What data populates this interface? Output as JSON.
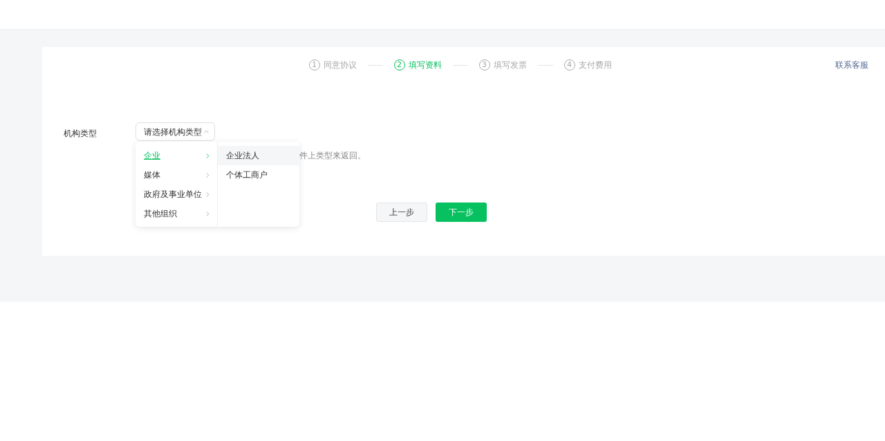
{
  "steps": [
    {
      "number": "1",
      "label": "同意协议",
      "selected": false
    },
    {
      "number": "2",
      "label": "填写资料",
      "selected": true
    },
    {
      "number": "3",
      "label": "填写发票",
      "selected": false
    },
    {
      "number": "4",
      "label": "支付费用",
      "selected": false
    }
  ],
  "contact_link": "联系客服",
  "form": {
    "label": "机构类型",
    "select": {
      "placeholder": "请选择机构类型",
      "expanded": true
    },
    "hint": "件上类型来返回。"
  },
  "menu": {
    "items": [
      {
        "label": "企业",
        "selected": true
      },
      {
        "label": "媒体",
        "selected": false
      },
      {
        "label": "政府及事业单位",
        "selected": false
      },
      {
        "label": "其他组织",
        "selected": false
      }
    ],
    "submenu": [
      {
        "label": "企业法人",
        "highlighted": true
      },
      {
        "label": "个体工商户",
        "highlighted": false
      }
    ]
  },
  "buttons": {
    "back": "上一步",
    "next": "下一步"
  }
}
